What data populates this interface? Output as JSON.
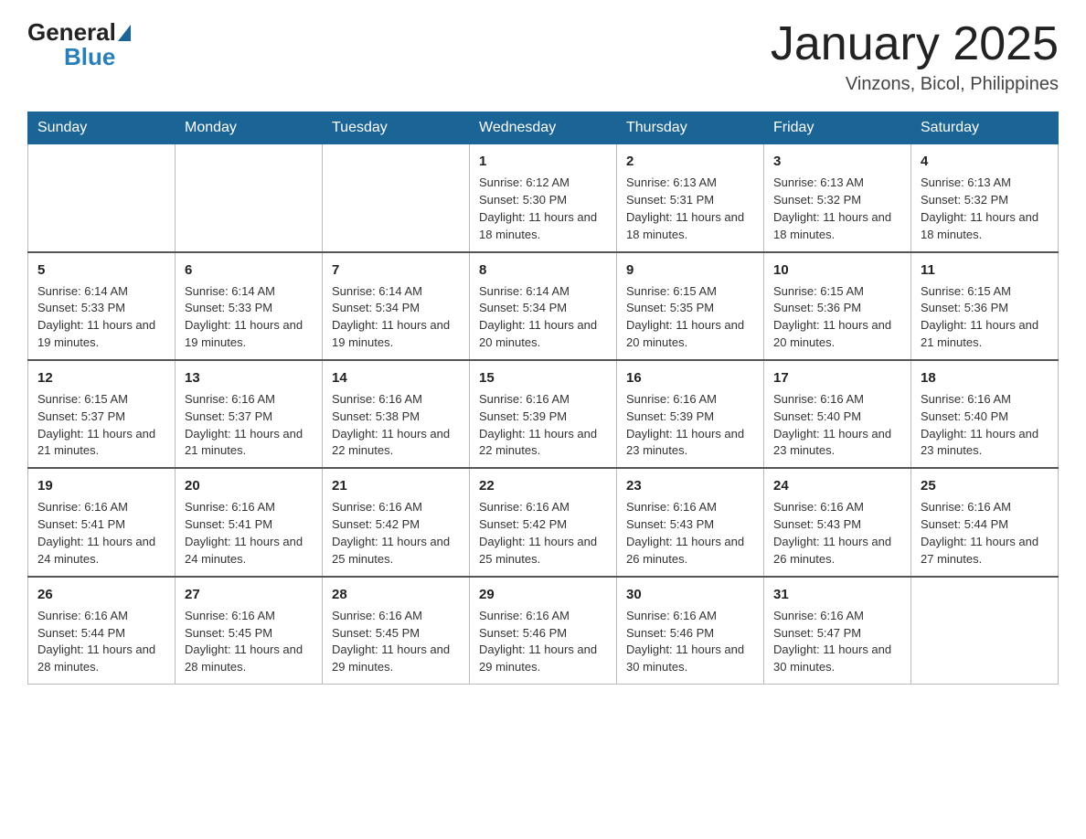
{
  "header": {
    "logo_general": "General",
    "logo_blue": "Blue",
    "month_title": "January 2025",
    "location": "Vinzons, Bicol, Philippines"
  },
  "days_of_week": [
    "Sunday",
    "Monday",
    "Tuesday",
    "Wednesday",
    "Thursday",
    "Friday",
    "Saturday"
  ],
  "weeks": [
    [
      {
        "day": "",
        "info": ""
      },
      {
        "day": "",
        "info": ""
      },
      {
        "day": "",
        "info": ""
      },
      {
        "day": "1",
        "info": "Sunrise: 6:12 AM\nSunset: 5:30 PM\nDaylight: 11 hours and 18 minutes."
      },
      {
        "day": "2",
        "info": "Sunrise: 6:13 AM\nSunset: 5:31 PM\nDaylight: 11 hours and 18 minutes."
      },
      {
        "day": "3",
        "info": "Sunrise: 6:13 AM\nSunset: 5:32 PM\nDaylight: 11 hours and 18 minutes."
      },
      {
        "day": "4",
        "info": "Sunrise: 6:13 AM\nSunset: 5:32 PM\nDaylight: 11 hours and 18 minutes."
      }
    ],
    [
      {
        "day": "5",
        "info": "Sunrise: 6:14 AM\nSunset: 5:33 PM\nDaylight: 11 hours and 19 minutes."
      },
      {
        "day": "6",
        "info": "Sunrise: 6:14 AM\nSunset: 5:33 PM\nDaylight: 11 hours and 19 minutes."
      },
      {
        "day": "7",
        "info": "Sunrise: 6:14 AM\nSunset: 5:34 PM\nDaylight: 11 hours and 19 minutes."
      },
      {
        "day": "8",
        "info": "Sunrise: 6:14 AM\nSunset: 5:34 PM\nDaylight: 11 hours and 20 minutes."
      },
      {
        "day": "9",
        "info": "Sunrise: 6:15 AM\nSunset: 5:35 PM\nDaylight: 11 hours and 20 minutes."
      },
      {
        "day": "10",
        "info": "Sunrise: 6:15 AM\nSunset: 5:36 PM\nDaylight: 11 hours and 20 minutes."
      },
      {
        "day": "11",
        "info": "Sunrise: 6:15 AM\nSunset: 5:36 PM\nDaylight: 11 hours and 21 minutes."
      }
    ],
    [
      {
        "day": "12",
        "info": "Sunrise: 6:15 AM\nSunset: 5:37 PM\nDaylight: 11 hours and 21 minutes."
      },
      {
        "day": "13",
        "info": "Sunrise: 6:16 AM\nSunset: 5:37 PM\nDaylight: 11 hours and 21 minutes."
      },
      {
        "day": "14",
        "info": "Sunrise: 6:16 AM\nSunset: 5:38 PM\nDaylight: 11 hours and 22 minutes."
      },
      {
        "day": "15",
        "info": "Sunrise: 6:16 AM\nSunset: 5:39 PM\nDaylight: 11 hours and 22 minutes."
      },
      {
        "day": "16",
        "info": "Sunrise: 6:16 AM\nSunset: 5:39 PM\nDaylight: 11 hours and 23 minutes."
      },
      {
        "day": "17",
        "info": "Sunrise: 6:16 AM\nSunset: 5:40 PM\nDaylight: 11 hours and 23 minutes."
      },
      {
        "day": "18",
        "info": "Sunrise: 6:16 AM\nSunset: 5:40 PM\nDaylight: 11 hours and 23 minutes."
      }
    ],
    [
      {
        "day": "19",
        "info": "Sunrise: 6:16 AM\nSunset: 5:41 PM\nDaylight: 11 hours and 24 minutes."
      },
      {
        "day": "20",
        "info": "Sunrise: 6:16 AM\nSunset: 5:41 PM\nDaylight: 11 hours and 24 minutes."
      },
      {
        "day": "21",
        "info": "Sunrise: 6:16 AM\nSunset: 5:42 PM\nDaylight: 11 hours and 25 minutes."
      },
      {
        "day": "22",
        "info": "Sunrise: 6:16 AM\nSunset: 5:42 PM\nDaylight: 11 hours and 25 minutes."
      },
      {
        "day": "23",
        "info": "Sunrise: 6:16 AM\nSunset: 5:43 PM\nDaylight: 11 hours and 26 minutes."
      },
      {
        "day": "24",
        "info": "Sunrise: 6:16 AM\nSunset: 5:43 PM\nDaylight: 11 hours and 26 minutes."
      },
      {
        "day": "25",
        "info": "Sunrise: 6:16 AM\nSunset: 5:44 PM\nDaylight: 11 hours and 27 minutes."
      }
    ],
    [
      {
        "day": "26",
        "info": "Sunrise: 6:16 AM\nSunset: 5:44 PM\nDaylight: 11 hours and 28 minutes."
      },
      {
        "day": "27",
        "info": "Sunrise: 6:16 AM\nSunset: 5:45 PM\nDaylight: 11 hours and 28 minutes."
      },
      {
        "day": "28",
        "info": "Sunrise: 6:16 AM\nSunset: 5:45 PM\nDaylight: 11 hours and 29 minutes."
      },
      {
        "day": "29",
        "info": "Sunrise: 6:16 AM\nSunset: 5:46 PM\nDaylight: 11 hours and 29 minutes."
      },
      {
        "day": "30",
        "info": "Sunrise: 6:16 AM\nSunset: 5:46 PM\nDaylight: 11 hours and 30 minutes."
      },
      {
        "day": "31",
        "info": "Sunrise: 6:16 AM\nSunset: 5:47 PM\nDaylight: 11 hours and 30 minutes."
      },
      {
        "day": "",
        "info": ""
      }
    ]
  ]
}
